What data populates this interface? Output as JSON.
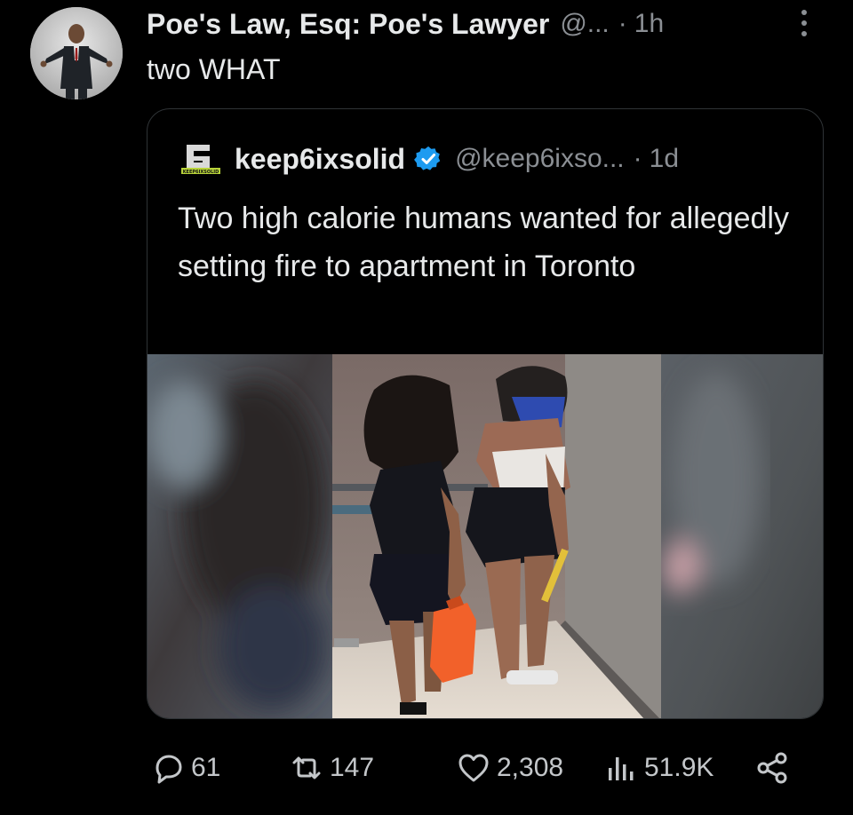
{
  "post": {
    "author_name": "Poe's Law, Esq: Poe's Lawyer",
    "author_handle": "@...",
    "separator": "·",
    "time": "1h",
    "text": "two WHAT"
  },
  "quote": {
    "author_name": "keep6ixsolid",
    "author_handle": "@keep6ixso...",
    "separator": "·",
    "time": "1d",
    "text": "Two high calorie humans wanted for allegedly setting fire to apartment in Toronto",
    "logo_text": "KEEP6IXSOLID"
  },
  "actions": {
    "replies": "61",
    "reposts": "147",
    "likes": "2,308",
    "views": "51.9K"
  },
  "icons": {
    "more": "more-vertical-icon",
    "verified": "verified-badge-icon",
    "reply": "reply-icon",
    "repost": "repost-icon",
    "like": "heart-icon",
    "views": "views-chart-icon",
    "share": "share-icon"
  },
  "colors": {
    "background": "#000000",
    "text_primary": "#e7e9ea",
    "text_secondary": "#8b8f94",
    "verified_blue": "#1d9bf0",
    "card_border": "#2f3336"
  }
}
